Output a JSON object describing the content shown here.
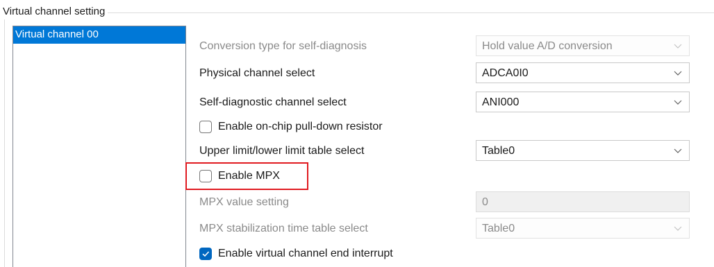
{
  "group": {
    "title": "Virtual channel setting"
  },
  "channel_list": {
    "items": [
      {
        "label": "Virtual channel 00",
        "selected": true
      }
    ]
  },
  "settings": {
    "conversion_type": {
      "label": "Conversion type for self-diagnosis",
      "value": "Hold value A/D conversion",
      "enabled": false
    },
    "physical_channel": {
      "label": "Physical channel select",
      "value": "ADCA0I0",
      "enabled": true
    },
    "self_diag_channel": {
      "label": "Self-diagnostic channel select",
      "value": "ANI000",
      "enabled": true
    },
    "pulldown": {
      "label": "Enable on-chip pull-down resistor",
      "checked": false
    },
    "limit_table": {
      "label": "Upper limit/lower limit table select",
      "value": "Table0",
      "enabled": true
    },
    "mpx": {
      "label": "Enable MPX",
      "checked": false,
      "highlighted": true
    },
    "mpx_value": {
      "label": "MPX value setting",
      "value": "0",
      "enabled": false
    },
    "mpx_stabilization": {
      "label": "MPX stabilization time table select",
      "value": "Table0",
      "enabled": false
    },
    "end_interrupt": {
      "label": "Enable virtual channel end interrupt",
      "checked": true
    }
  },
  "colors": {
    "selection": "#0078d7",
    "checkbox_checked": "#0067c0",
    "highlight": "#e0191f",
    "disabled_text": "#8a8a8a"
  },
  "icons": {
    "dropdown": "chevron-down-icon",
    "check": "checkmark-icon"
  }
}
